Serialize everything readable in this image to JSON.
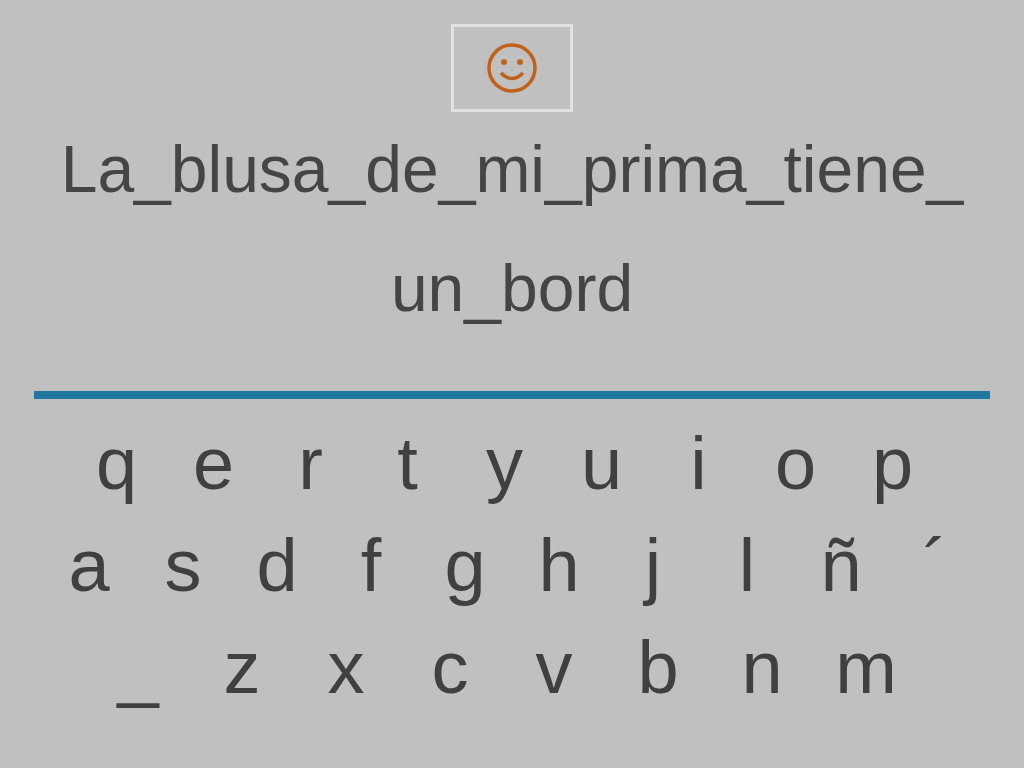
{
  "prompt_lines": [
    "La_blusa_de_mi_prima_tiene_",
    "un_bord"
  ],
  "keyboard_rows": [
    [
      "q",
      "e",
      "r",
      "t",
      "y",
      "u",
      "i",
      "o",
      "p"
    ],
    [
      "a",
      "s",
      "d",
      "f",
      "g",
      "h",
      "j",
      "l",
      "ñ",
      "´"
    ],
    [
      "_",
      "z",
      "x",
      "c",
      "v",
      "b",
      "n",
      "m"
    ]
  ]
}
